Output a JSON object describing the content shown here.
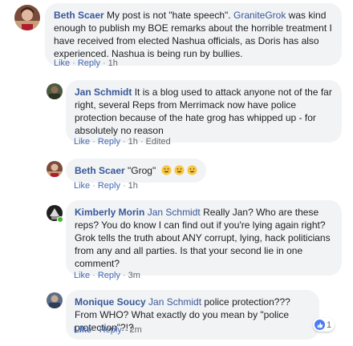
{
  "comments": [
    {
      "author": "Beth Scaer",
      "text_before": " My post is not \"hate speech\". ",
      "mention": "GraniteGrok",
      "text_after": " was kind enough to publish my BOE remarks about the horrible treatment I have received from elected Nashua officials, as Doris has also experienced. Nashua is being run by bullies.",
      "like_label": "Like",
      "reply_label": "Reply",
      "time": "1h"
    },
    {
      "author": "Jan Schmidt",
      "text": " It is a blog used to attack anyone not of the far right, several Reps from Merrimack now have police protection because of the hate grog has whipped up - for absolutely no reason",
      "like_label": "Like",
      "reply_label": "Reply",
      "time": "1h",
      "edited_label": "Edited"
    },
    {
      "author": "Beth Scaer",
      "text": " \"Grog\"",
      "emoji": [
        "grinning-face-icon",
        "grinning-face-icon",
        "grinning-face-icon"
      ],
      "like_label": "Like",
      "reply_label": "Reply",
      "time": "1h"
    },
    {
      "author": "Kimberly Morin",
      "mention": "Jan Schmidt",
      "text": " Really Jan? Who are these reps? You do know I can find out if you're lying again right? Grok tells the truth about ANY corrupt, lying, hack politicians from any and all parties. Is that your second lie in one comment?",
      "like_label": "Like",
      "reply_label": "Reply",
      "time": "3m",
      "online": true
    },
    {
      "author": "Monique Soucy",
      "mention": "Jan Schmidt",
      "text": " police protection??? From WHO? What exactly do you mean by \"police protection\"?!?",
      "like_label": "Like",
      "reply_label": "Reply",
      "time": "2m",
      "reaction_count": "1",
      "reaction_icon": "like-icon"
    }
  ],
  "colors": {
    "author": "#385898",
    "bubble": "#f2f3f5",
    "link": "#4267b2",
    "meta": "#606770",
    "online": "#42b72a",
    "like_blue": "#4a7cf6"
  }
}
